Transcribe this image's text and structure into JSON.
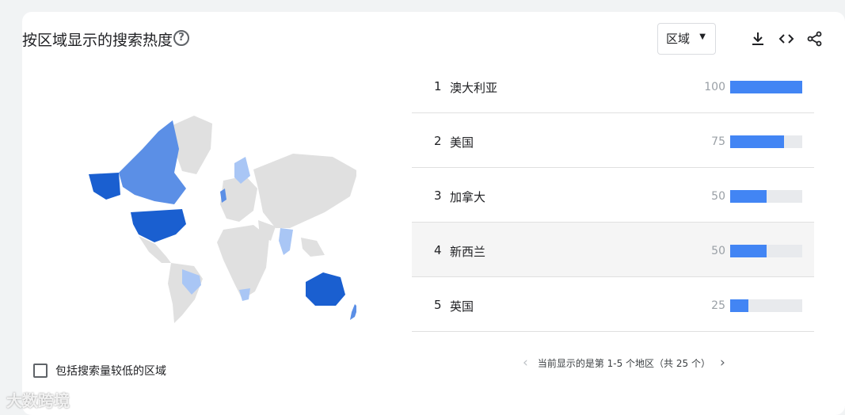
{
  "widget": {
    "title": "按区域显示的搜索热度",
    "help_icon": "?",
    "resolution_select": "区域",
    "tools": [
      "download-icon",
      "embed-icon",
      "share-icon"
    ]
  },
  "ranking": [
    {
      "rank": "1",
      "region": "澳大利亚",
      "value": "100",
      "fraction": 1.0
    },
    {
      "rank": "2",
      "region": "美国",
      "value": "75",
      "fraction": 0.75
    },
    {
      "rank": "3",
      "region": "加拿大",
      "value": "50",
      "fraction": 0.5
    },
    {
      "rank": "4",
      "region": "新西兰",
      "value": "50",
      "fraction": 0.5
    },
    {
      "rank": "5",
      "region": "英国",
      "value": "25",
      "fraction": 0.25
    }
  ],
  "pager": {
    "text": "当前显示的是第 1-5 个地区（共 25 个）"
  },
  "checkbox_label": "包括搜索量较低的区域",
  "watermark": "大数跨境",
  "colors": {
    "bar": "#4285f4",
    "strong": "#1a5fd0",
    "mid": "#5b8fe6",
    "light": "#a9c6f5",
    "land": "#e0e0e0"
  }
}
